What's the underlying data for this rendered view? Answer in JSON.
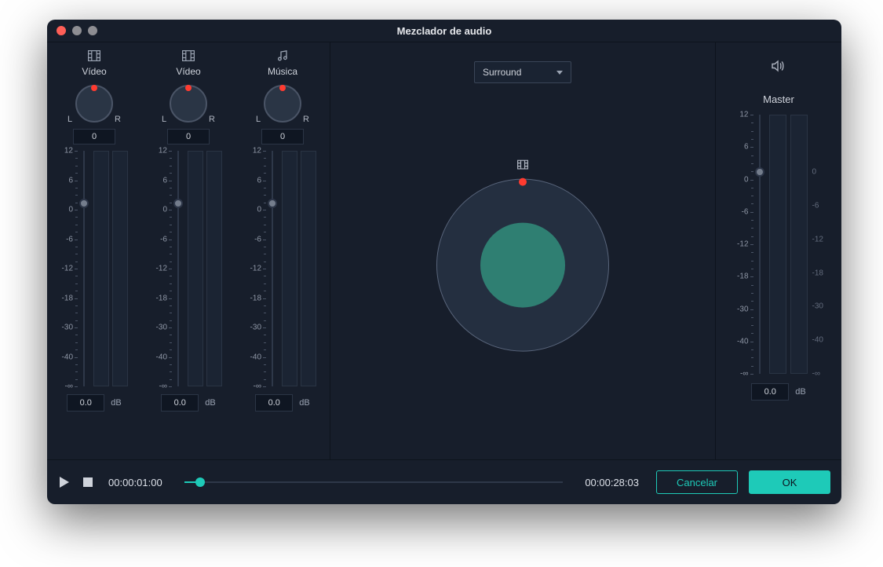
{
  "window": {
    "title": "Mezclador de audio"
  },
  "channels": [
    {
      "icon": "video",
      "label": "Vídeo",
      "pan_left": "L",
      "pan_right": "R",
      "pan_value": "0",
      "gain_value": "0.0",
      "db_unit": "dB"
    },
    {
      "icon": "video",
      "label": "Vídeo",
      "pan_left": "L",
      "pan_right": "R",
      "pan_value": "0",
      "gain_value": "0.0",
      "db_unit": "dB"
    },
    {
      "icon": "music",
      "label": "Música",
      "pan_left": "L",
      "pan_right": "R",
      "pan_value": "0",
      "gain_value": "0.0",
      "db_unit": "dB"
    }
  ],
  "scale_labels": [
    "12",
    "6",
    "0",
    "-6",
    "-12",
    "-18",
    "-30",
    "-40",
    "-∞"
  ],
  "master_scale_labels": [
    "12",
    "6",
    "0",
    "-6",
    "-12",
    "-18",
    "-30",
    "-40",
    "-∞"
  ],
  "master_scale_right_labels": [
    "0",
    "-6",
    "-12",
    "-18",
    "-30",
    "-40",
    "-∞"
  ],
  "surround": {
    "select": "Surround"
  },
  "master": {
    "label": "Master",
    "gain_value": "0.0",
    "db_unit": "dB"
  },
  "footer": {
    "current_time": "00:00:01:00",
    "total_time": "00:00:28:03",
    "cancel": "Cancelar",
    "ok": "OK"
  },
  "fader_zero_pct": 22.2,
  "master_fader_zero_pct": 22.2,
  "colors": {
    "accent": "#1ecab8",
    "danger": "#ff3b30"
  }
}
